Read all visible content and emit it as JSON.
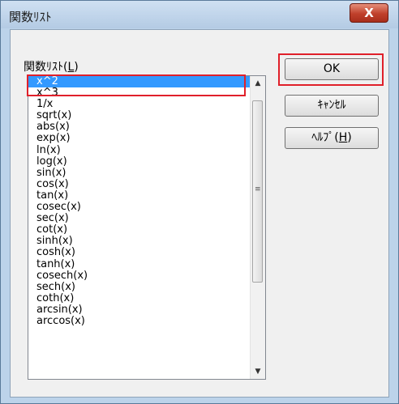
{
  "window": {
    "title": "関数ﾘｽﾄ",
    "close_symbol": "X"
  },
  "list": {
    "label_text": "関数ﾘｽﾄ(",
    "label_key": "L",
    "label_close": ")",
    "selected_index": 0,
    "items": [
      "x^2",
      "x^3",
      "1/x",
      "sqrt(x)",
      "abs(x)",
      "exp(x)",
      "ln(x)",
      "log(x)",
      "sin(x)",
      "cos(x)",
      "tan(x)",
      "cosec(x)",
      "sec(x)",
      "cot(x)",
      "sinh(x)",
      "cosh(x)",
      "tanh(x)",
      "cosech(x)",
      "sech(x)",
      "coth(x)",
      "arcsin(x)",
      "arccos(x)"
    ]
  },
  "scrollbar": {
    "up_symbol": "▲",
    "down_symbol": "▼",
    "grip_symbol": "≡"
  },
  "buttons": {
    "ok_label": "OK",
    "cancel_label": "ｷｬﾝｾﾙ",
    "help_label": "ﾍﾙﾌﾟ(",
    "help_key": "H",
    "help_close": ")"
  },
  "colors": {
    "highlight": "#e0202a",
    "selection": "#3399ff",
    "close_button": "#c0402b"
  }
}
